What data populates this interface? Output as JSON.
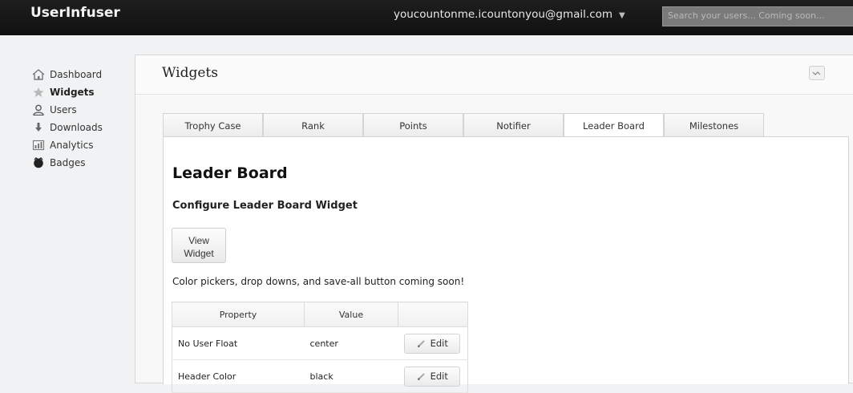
{
  "topbar": {
    "brand": "UserInfuser",
    "account_email": "youcountonme.icountonyou@gmail.com",
    "search_placeholder": "Search your users... Coming soon..."
  },
  "sidebar": {
    "items": [
      {
        "label": "Dashboard",
        "icon": "home-icon",
        "active": false
      },
      {
        "label": "Widgets",
        "icon": "star-icon",
        "active": true
      },
      {
        "label": "Users",
        "icon": "user-icon",
        "active": false
      },
      {
        "label": "Downloads",
        "icon": "download-icon",
        "active": false
      },
      {
        "label": "Analytics",
        "icon": "chart-icon",
        "active": false
      },
      {
        "label": "Badges",
        "icon": "badge-icon",
        "active": false
      }
    ]
  },
  "main": {
    "title": "Widgets",
    "tabs": [
      {
        "label": "Trophy Case",
        "active": false
      },
      {
        "label": "Rank",
        "active": false
      },
      {
        "label": "Points",
        "active": false
      },
      {
        "label": "Notifier",
        "active": false
      },
      {
        "label": "Leader Board",
        "active": true
      },
      {
        "label": "Milestones",
        "active": false
      }
    ],
    "heading": "Leader Board",
    "subheading": "Configure Leader Board Widget",
    "view_button": "View Widget",
    "note": "Color pickers, drop downs, and save-all button coming soon!",
    "table": {
      "headers": [
        "Property",
        "Value",
        ""
      ],
      "rows": [
        {
          "property": "No User Float",
          "value": "center",
          "action": "Edit"
        },
        {
          "property": "Header Color",
          "value": "black",
          "action": "Edit"
        }
      ]
    }
  },
  "colors": {
    "topbar_bg": "#111111",
    "panel_bg": "#f8f8f8",
    "content_bg": "#ffffff"
  }
}
